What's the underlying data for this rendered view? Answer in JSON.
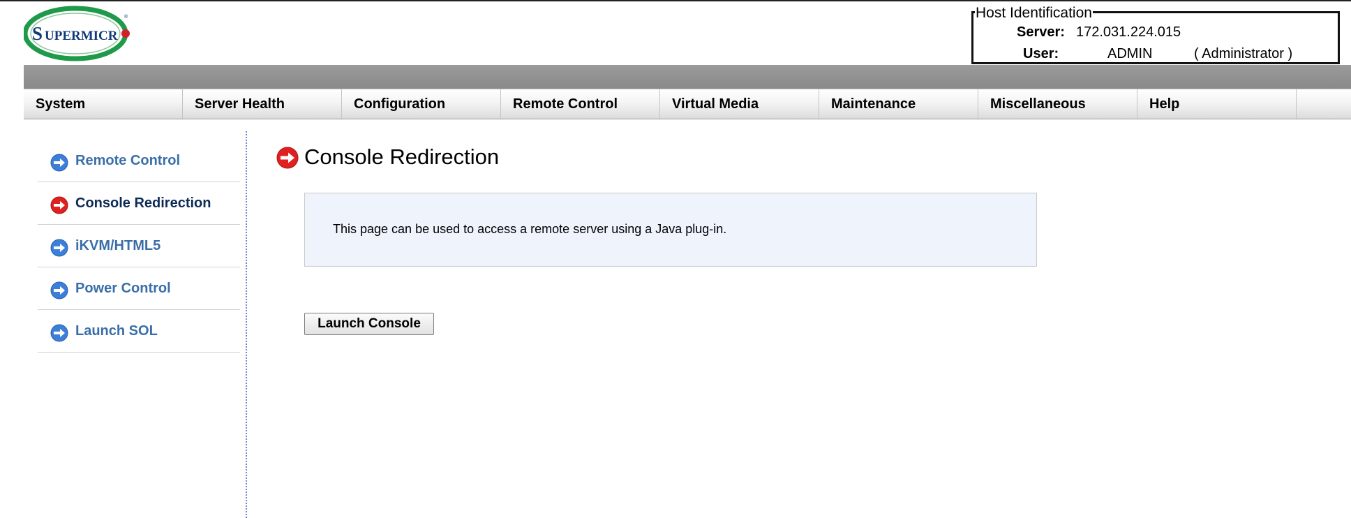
{
  "brand": {
    "logo_text_big": "S",
    "logo_text_rest": "UPERMICR",
    "logo_dot": "●",
    "registered_mark": "®",
    "logo_ring_color": "#1e9a4a",
    "logo_dot_color": "#d32027",
    "logo_text_color": "#103a78"
  },
  "host": {
    "legend": "Host Identification",
    "server_label": "Server:",
    "server_value": "172.031.224.015",
    "user_label": "User:",
    "user_value": "ADMIN",
    "user_role": "( Administrator )"
  },
  "nav": {
    "items": [
      {
        "label": "System"
      },
      {
        "label": "Server Health"
      },
      {
        "label": "Configuration"
      },
      {
        "label": "Remote Control"
      },
      {
        "label": "Virtual Media"
      },
      {
        "label": "Maintenance"
      },
      {
        "label": "Miscellaneous"
      },
      {
        "label": "Help"
      }
    ]
  },
  "sidebar": {
    "items": [
      {
        "label": "Remote Control",
        "icon": "arrow-right-blue-icon",
        "active": false
      },
      {
        "label": "Console Redirection",
        "icon": "arrow-right-red-icon",
        "active": true
      },
      {
        "label": "iKVM/HTML5",
        "icon": "arrow-right-blue-icon",
        "active": false
      },
      {
        "label": "Power Control",
        "icon": "arrow-right-blue-icon",
        "active": false
      },
      {
        "label": "Launch SOL",
        "icon": "arrow-right-blue-icon",
        "active": false
      }
    ]
  },
  "main": {
    "title": "Console Redirection",
    "title_icon": "arrow-right-red-icon",
    "description": "This page can be used to access a remote server using a Java plug-in.",
    "launch_button": "Launch Console"
  },
  "colors": {
    "link_blue": "#3a6ea8",
    "active_navy": "#0d2a57",
    "icon_blue": "#3b7fd8",
    "icon_red": "#e02020",
    "info_bg": "#eff3fc"
  }
}
